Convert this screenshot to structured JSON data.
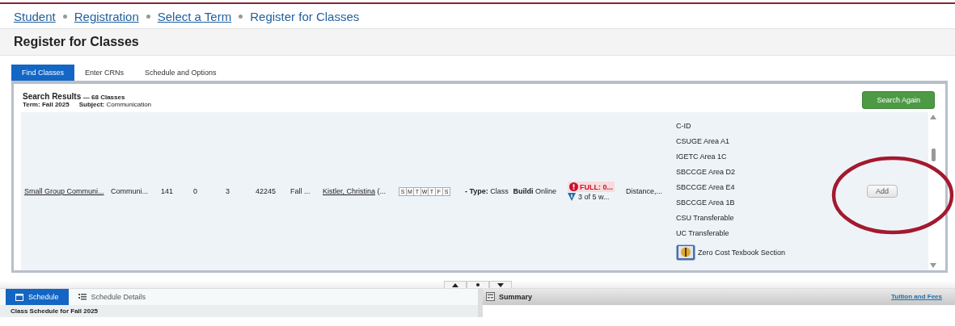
{
  "breadcrumb": [
    {
      "label": "Student",
      "link": true
    },
    {
      "label": "Registration",
      "link": true
    },
    {
      "label": "Select a Term",
      "link": true
    },
    {
      "label": "Register for Classes",
      "link": false
    }
  ],
  "page_title": "Register for Classes",
  "tabs": [
    {
      "label": "Find Classes",
      "selected": true
    },
    {
      "label": "Enter CRNs",
      "selected": false
    },
    {
      "label": "Schedule and Options",
      "selected": false
    }
  ],
  "results": {
    "heading": "Search Results",
    "count": "— 68 Classes",
    "term_label": "Term:",
    "term": "Fall 2025",
    "subject_label": "Subject:",
    "subject": "Communication",
    "search_again": "Search Again"
  },
  "row": {
    "title": "Small Group Communi...",
    "subject": "Communi...",
    "course": "141",
    "section": "0",
    "hours": "3",
    "crn": "42245",
    "term": "Fall ...",
    "instructor": "Kistler, Christina",
    "instructor_more": "(...",
    "days": [
      "S",
      "M",
      "T",
      "W",
      "T",
      "F",
      "S"
    ],
    "type_label": "- Type:",
    "type": "Class",
    "building": "Buildi",
    "campus": "Online",
    "status": "FULL: 0...",
    "waitlist": "3 of 5 w...",
    "method": "Distance,...",
    "attributes": [
      "C-ID",
      "CSUGE Area A1",
      "IGETC Area 1C",
      "SBCCGE Area D2",
      "SBCCGE Area E4",
      "SBCCGE Area 1B",
      "CSU Transferable",
      "UC Transferable"
    ],
    "zero_cost": "Zero Cost Texbook Section",
    "add": "Add"
  },
  "bottom_tabs": [
    {
      "label": "Schedule",
      "selected": true
    },
    {
      "label": "Schedule Details",
      "selected": false
    }
  ],
  "schedule_heading": "Class Schedule for Fall 2025",
  "summary": {
    "title": "Summary",
    "link": "Tuition and Fees"
  }
}
